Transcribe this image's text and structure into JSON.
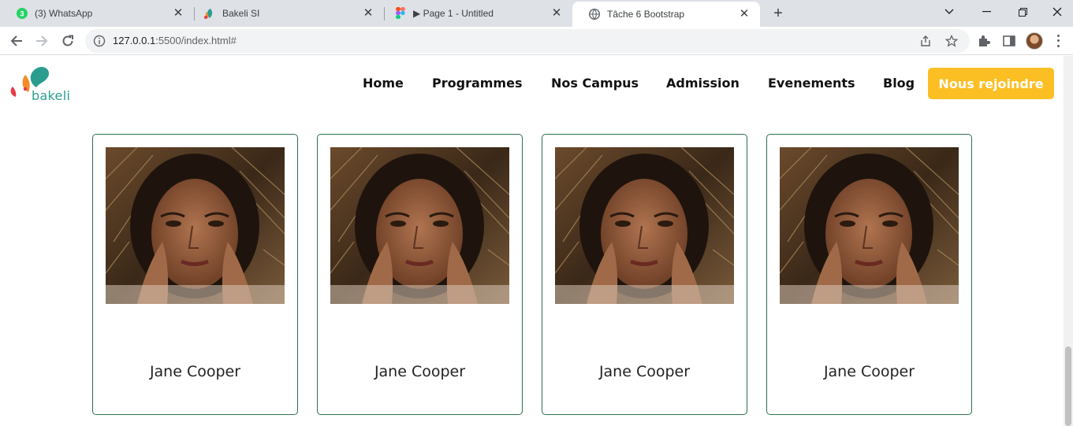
{
  "browser": {
    "tabs": [
      {
        "title": "(3) WhatsApp",
        "favicon": "whatsapp-icon",
        "badge": "3",
        "active": false
      },
      {
        "title": "Bakeli SI",
        "favicon": "bakeli-icon",
        "active": false
      },
      {
        "title": "▶ Page 1 - Untitled",
        "favicon": "figma-icon",
        "active": false
      },
      {
        "title": "Tâche 6 Bootstrap",
        "favicon": "globe-icon",
        "active": true
      }
    ],
    "url_host": "127.0.0.1",
    "url_rest": ":5500/index.html#"
  },
  "site": {
    "logo_text": "bakeli",
    "nav": [
      "Home",
      "Programmes",
      "Nos Campus",
      "Admission",
      "Evenements",
      "Blog"
    ],
    "cta": "Nous rejoindre",
    "cards": [
      {
        "name": "Jane Cooper"
      },
      {
        "name": "Jane Cooper"
      },
      {
        "name": "Jane Cooper"
      },
      {
        "name": "Jane Cooper"
      }
    ]
  },
  "colors": {
    "accent": "#2a9d8f",
    "cta": "#fbbf24",
    "card_border": "#2f6f4f",
    "logo_orange": "#f28c28",
    "logo_red": "#e63946"
  }
}
